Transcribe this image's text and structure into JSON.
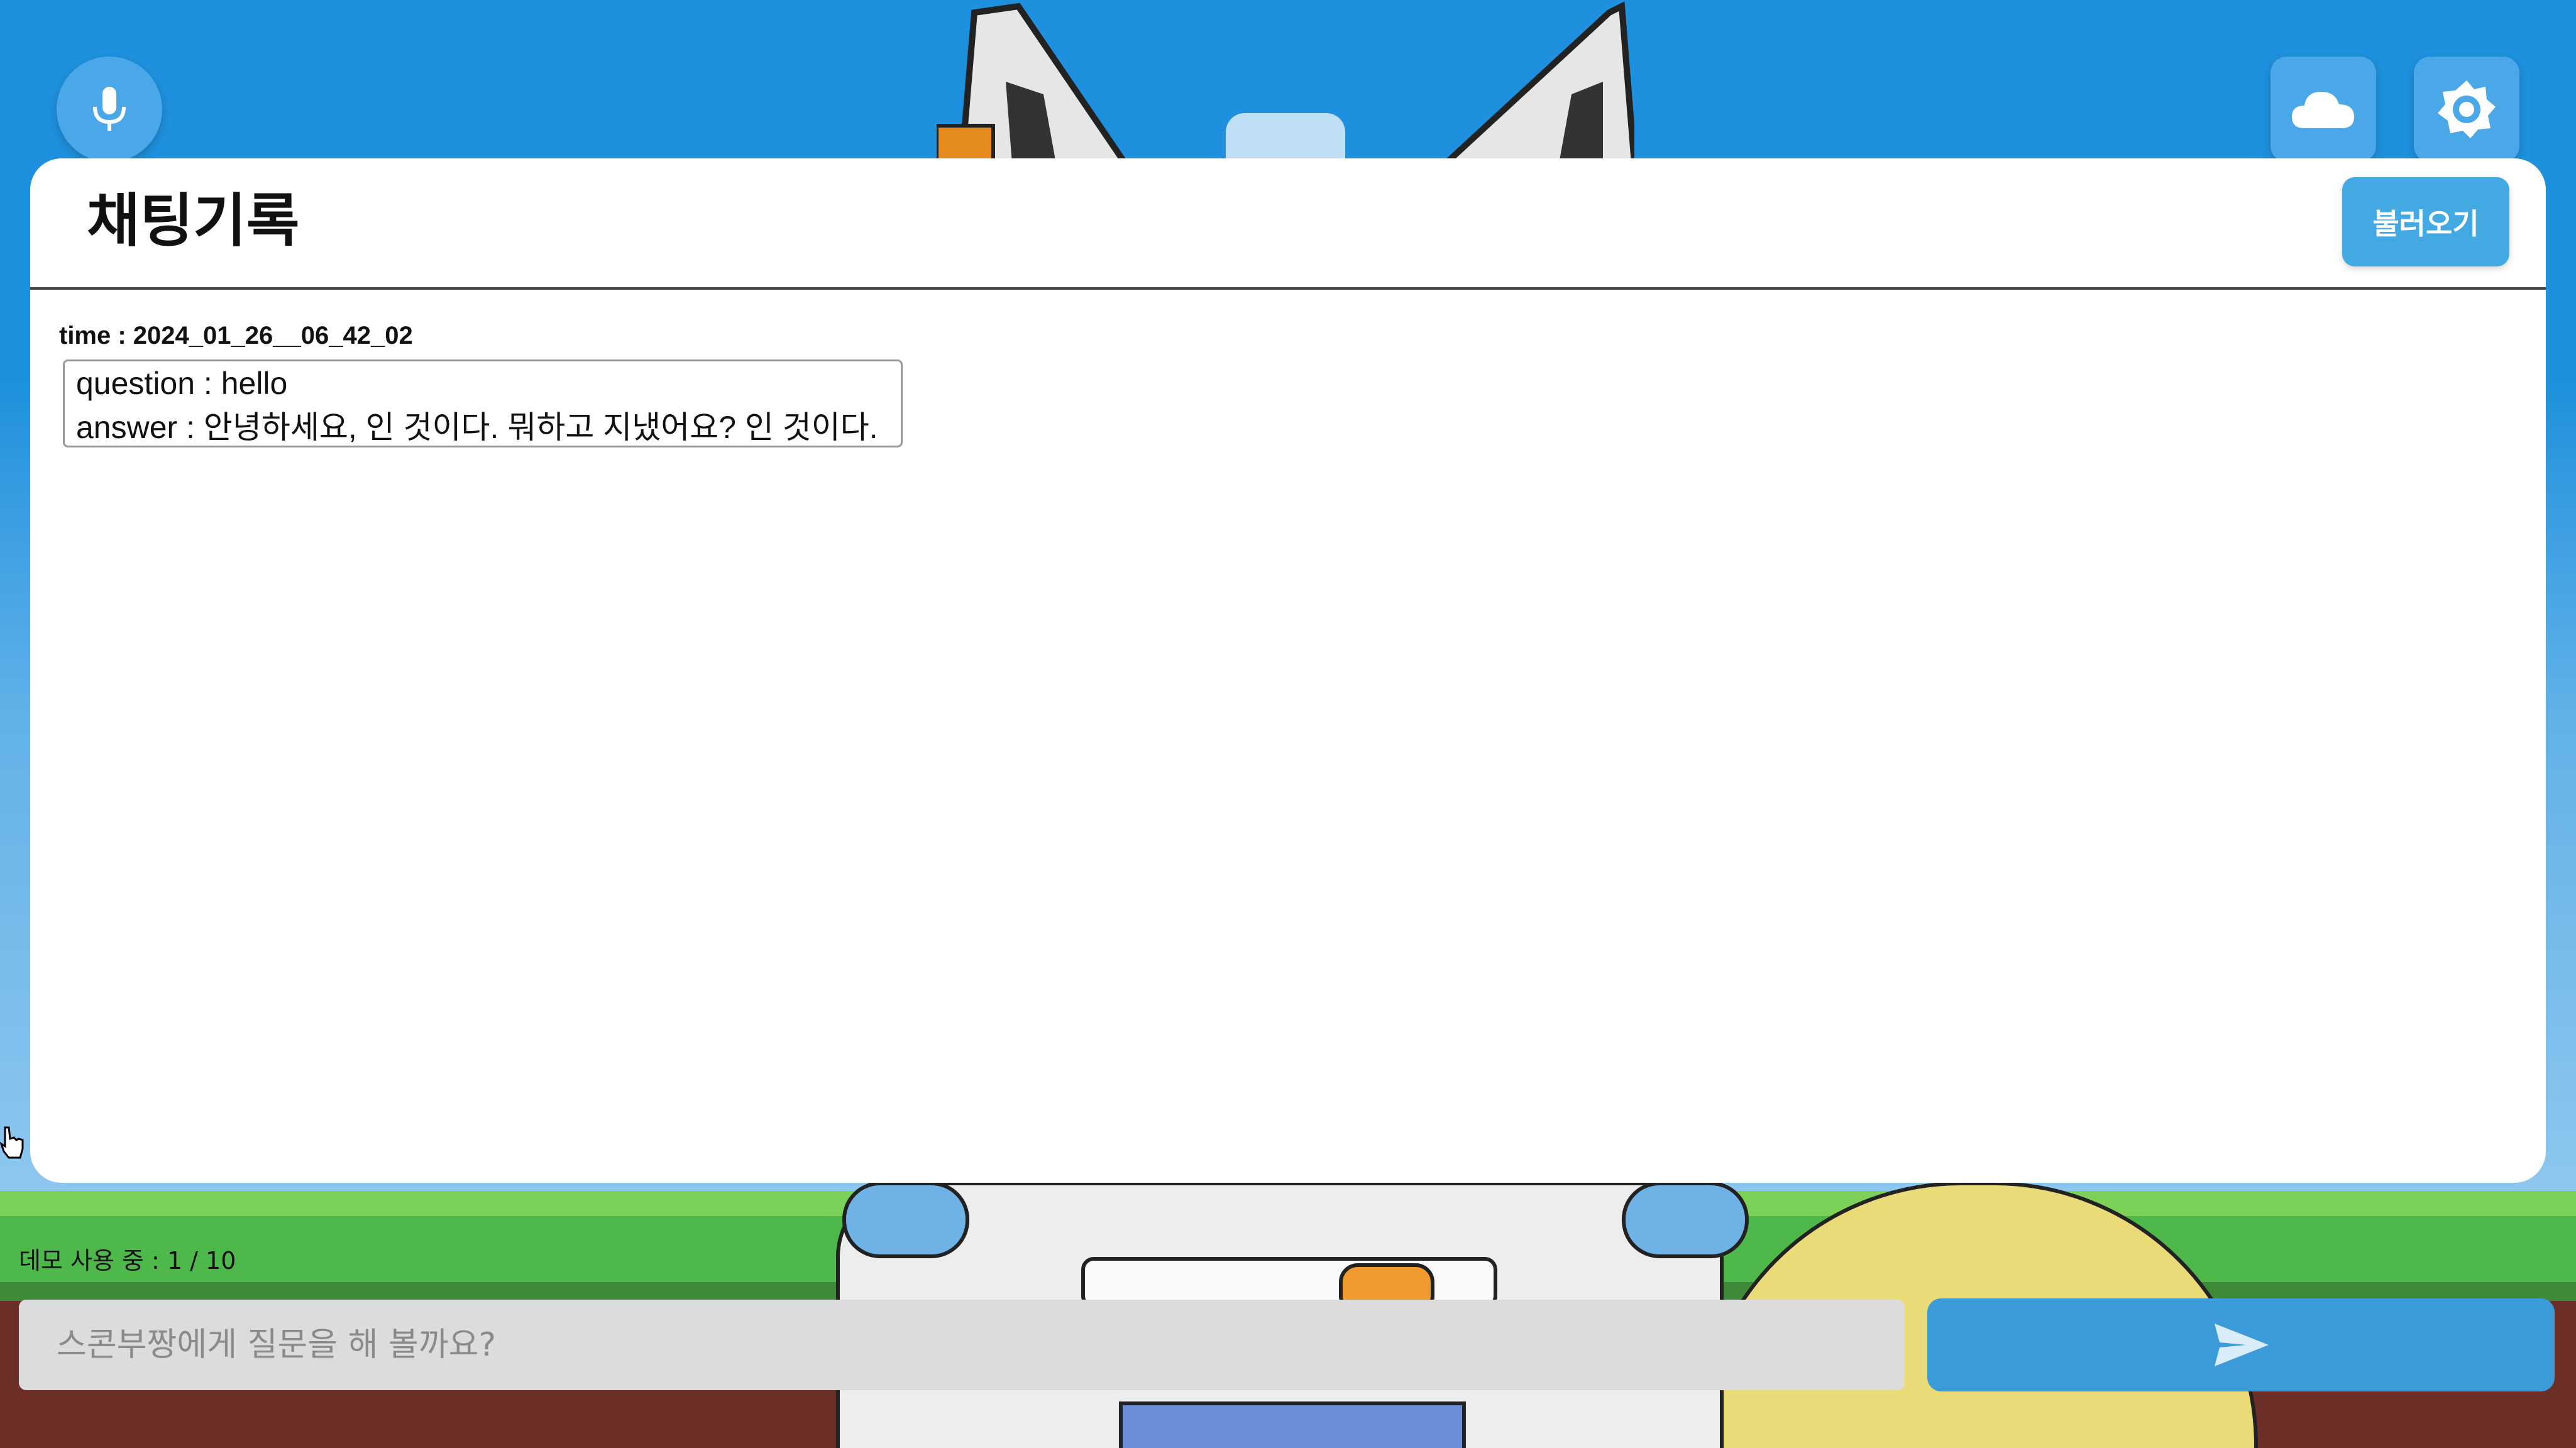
{
  "colors": {
    "sky": "#1e90dd",
    "button_blue": "#4aa8e8",
    "load_button": "#42a9e3",
    "send_button": "#3a9bd8",
    "input_bg": "#dcdcdc"
  },
  "toolbar": {
    "mic_icon": "microphone-icon",
    "cloud_icon": "cloud-icon",
    "settings_icon": "gear-icon"
  },
  "history_panel": {
    "title": "채팅기록",
    "load_button_label": "불러오기",
    "entries": [
      {
        "time": "time : 2024_01_26__06_42_02",
        "question": "question : hello",
        "answer": "answer : 안녕하세요, 인 것이다. 뭐하고 지냈어요? 인 것이다."
      }
    ]
  },
  "footer": {
    "demo_counter": "데모 사용 중 : 1 / 10",
    "input_placeholder": "스콘부짱에게 질문을 해 볼까요?",
    "input_value": "",
    "send_icon": "send-icon"
  }
}
